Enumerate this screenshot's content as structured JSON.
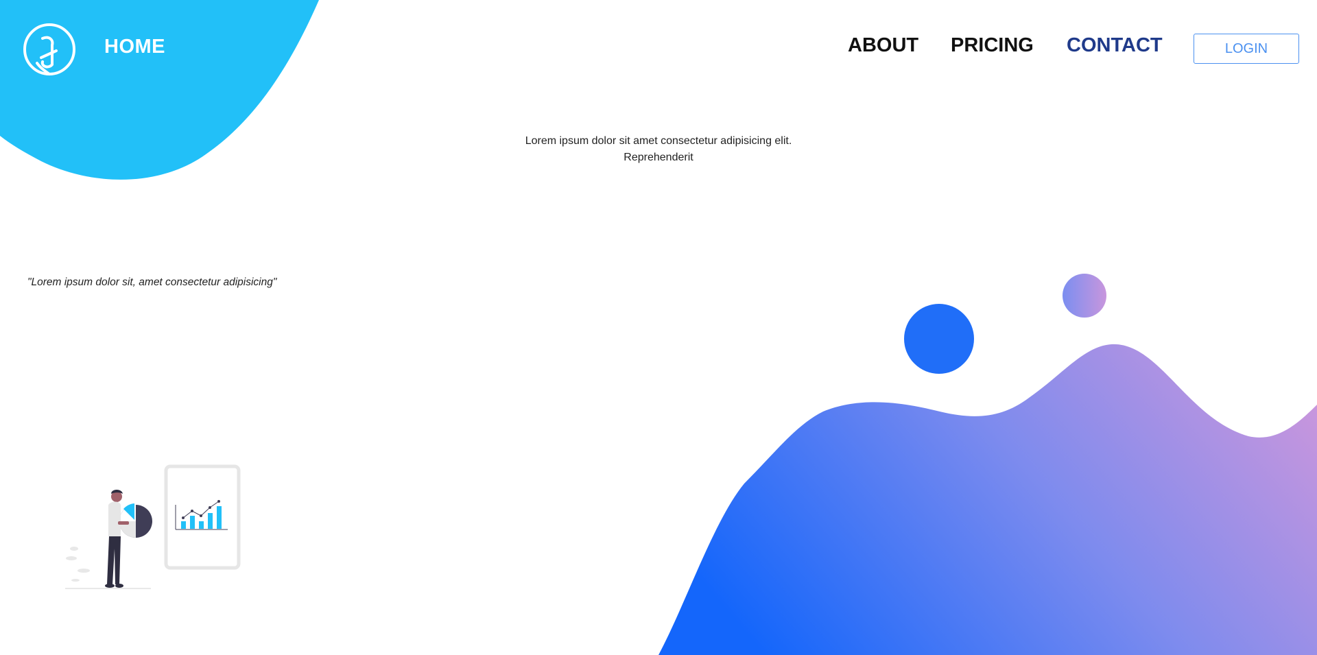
{
  "nav": {
    "home_label": "HOME",
    "about_label": "ABOUT",
    "pricing_label": "PRICING",
    "contact_label": "CONTACT",
    "login_label": "LOGIN"
  },
  "hero": {
    "description": "Lorem ipsum dolor sit amet consectetur adipisicing elit. Reprehenderit"
  },
  "quote": {
    "text": "\"Lorem ipsum dolor sit, amet consectetur adipisicing\""
  },
  "colors": {
    "top_blob": "#22c0f8",
    "contact_active": "#1f3a8a",
    "login_border": "#4a90f0",
    "wave_start": "#1466fb",
    "wave_end": "#c896dd",
    "blue_circle": "#206ef8"
  },
  "icons": {
    "logo": "music-note-circle-icon"
  }
}
